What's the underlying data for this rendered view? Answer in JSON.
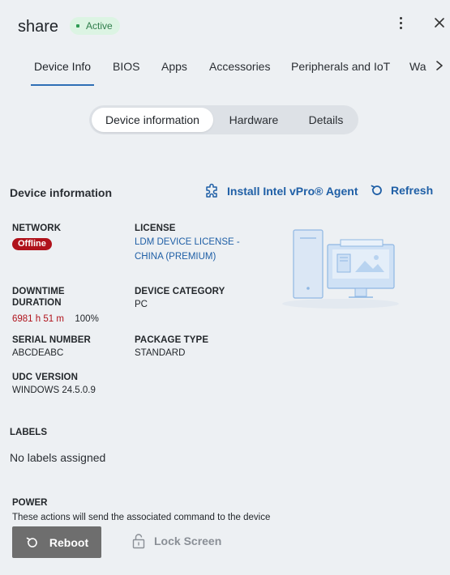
{
  "header": {
    "title": "share",
    "status": "Active"
  },
  "tabs": [
    {
      "label": "Device Info"
    },
    {
      "label": "BIOS"
    },
    {
      "label": "Apps"
    },
    {
      "label": "Accessories"
    },
    {
      "label": "Peripherals and IoT"
    },
    {
      "label": "Wa"
    }
  ],
  "segments": [
    {
      "label": "Device information"
    },
    {
      "label": "Hardware"
    },
    {
      "label": "Details"
    }
  ],
  "section": {
    "title": "Device information",
    "vpro_label": "Install Intel vPro® Agent",
    "refresh_label": "Refresh"
  },
  "fields": {
    "network_label": "NETWORK",
    "network_value": "Offline",
    "license_label": "LICENSE",
    "license_line1": "LDM DEVICE LICENSE -",
    "license_line2": "CHINA (PREMIUM)",
    "downtime_label_1": "DOWNTIME",
    "downtime_label_2": "DURATION",
    "downtime_hours": "6981 h 51 m",
    "downtime_pct": "100%",
    "category_label": "DEVICE CATEGORY",
    "category_value": "PC",
    "serial_label": "SERIAL NUMBER",
    "serial_value": "ABCDEABC",
    "package_label": "PACKAGE TYPE",
    "package_value": "STANDARD",
    "udc_label": "UDC VERSION",
    "udc_value": "WINDOWS 24.5.0.9"
  },
  "labels": {
    "title": "LABELS",
    "empty": "No labels assigned"
  },
  "power": {
    "title": "POWER",
    "description": "These actions will send the associated command to the device",
    "reboot_label": "Reboot",
    "lock_label": "Lock Screen"
  },
  "colors": {
    "accent": "#2f6fb5",
    "link": "#1f5fa6",
    "offline": "#b0121b",
    "active_badge_bg": "#dcf4e3",
    "background": "#edf0f3"
  }
}
